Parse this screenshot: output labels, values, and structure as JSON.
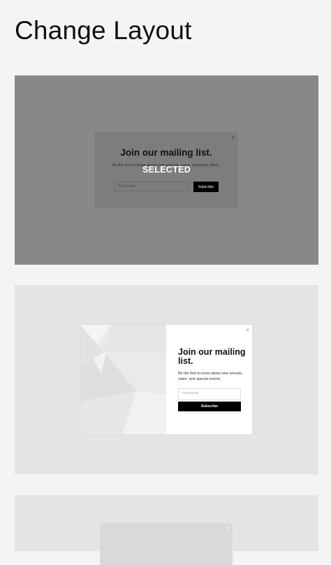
{
  "page": {
    "title": "Change Layout"
  },
  "layouts": [
    {
      "selected": true,
      "selected_label": "SELECTED",
      "popup": {
        "close_glyph": "×",
        "title": "Join our mailing list.",
        "description": "Be the first to know about new arrivals, sales, exclusive offers,",
        "email_placeholder": "Your Email",
        "button_label": "Subscribe"
      }
    },
    {
      "selected": false,
      "popup": {
        "close_glyph": "×",
        "title": "Join our mailing list.",
        "description": "Be the first to know about new arrivals, sales, and special events.",
        "email_placeholder": "Your Email",
        "button_label": "Subscribe"
      }
    },
    {
      "selected": false,
      "popup": {
        "close_glyph": "×"
      }
    }
  ],
  "colors": {
    "page_bg": "#f4f4f4",
    "selected_overlay": "#888888",
    "card_bg": "#e4e4e4",
    "button_bg": "#000000",
    "button_text": "#ffffff"
  }
}
